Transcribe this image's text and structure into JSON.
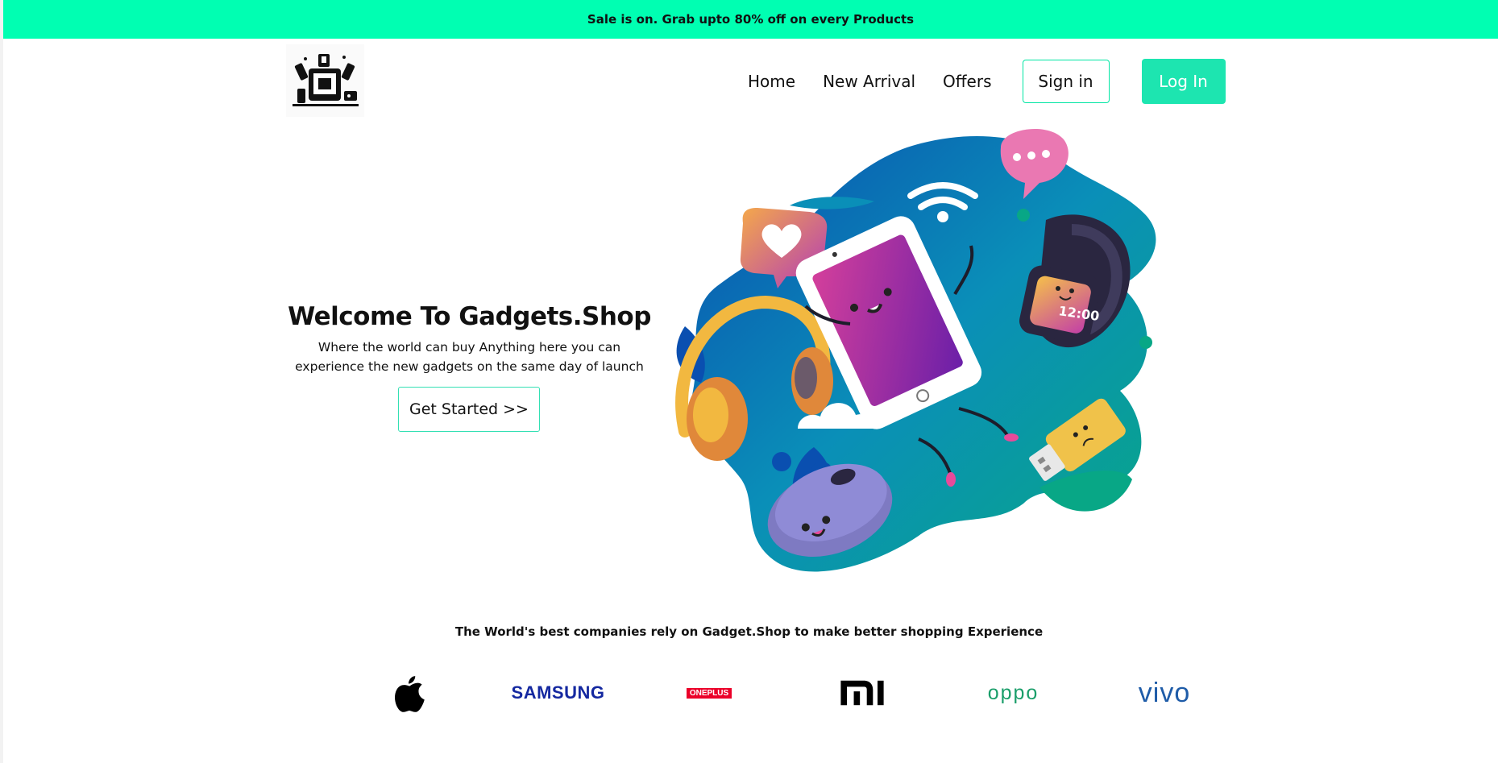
{
  "promo": {
    "text": "Sale is on. Grab upto 80% off on every Products"
  },
  "nav": {
    "home": "Home",
    "new_arrival": "New Arrival",
    "offers": "Offers",
    "sign_in": "Sign in",
    "log_in": "Log In"
  },
  "hero": {
    "title": "Welcome To Gadgets.Shop",
    "subtitle": "Where the world can buy Anything here you can experience the new gadgets on the same day of launch",
    "cta": "Get Started >>",
    "watch_time": "12:00"
  },
  "partners": {
    "title": "The World's best companies rely on Gadget.Shop to make better shopping Experience",
    "samsung": "SAMSUNG",
    "oneplus": "ONEPLUS",
    "oppo": "oppo",
    "vivo": "vivo"
  },
  "colors": {
    "promo_bg": "#00ffb2",
    "accent": "#1de5b0",
    "border": "#00e6a3",
    "samsung": "#1428a0",
    "oneplus": "#eb0029",
    "oppo": "#1a9e6a",
    "vivo": "#1f5ca8"
  },
  "icons": [
    "logo-icon",
    "gadgets-illustration",
    "apple-logo-icon",
    "mi-logo-icon"
  ]
}
